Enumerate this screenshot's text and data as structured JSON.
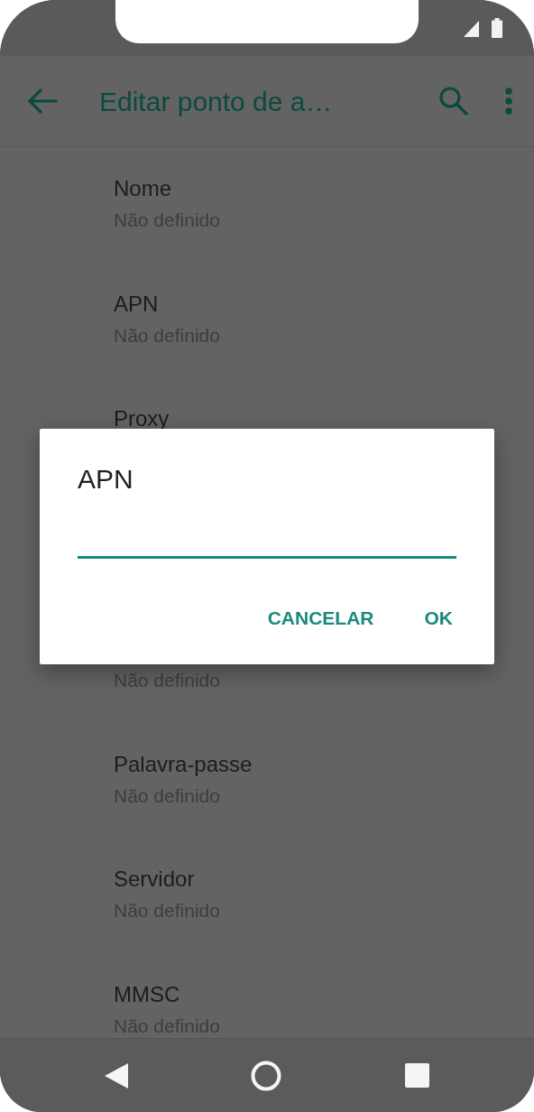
{
  "toolbar": {
    "title": "Editar ponto de a…"
  },
  "list": {
    "upper": [
      {
        "title": "Nome",
        "subtitle": "Não definido"
      },
      {
        "title": "APN",
        "subtitle": "Não definido"
      },
      {
        "title": "Proxy"
      }
    ],
    "lower": [
      {
        "subtitle": "Não definido"
      },
      {
        "title": "Palavra-passe",
        "subtitle": "Não definido"
      },
      {
        "title": "Servidor",
        "subtitle": "Não definido"
      },
      {
        "title": "MMSC",
        "subtitle": "Não definido"
      }
    ]
  },
  "dialog": {
    "title": "APN",
    "field": {
      "focused": true
    },
    "buttons": [
      "CANCELAR",
      "OK"
    ]
  }
}
